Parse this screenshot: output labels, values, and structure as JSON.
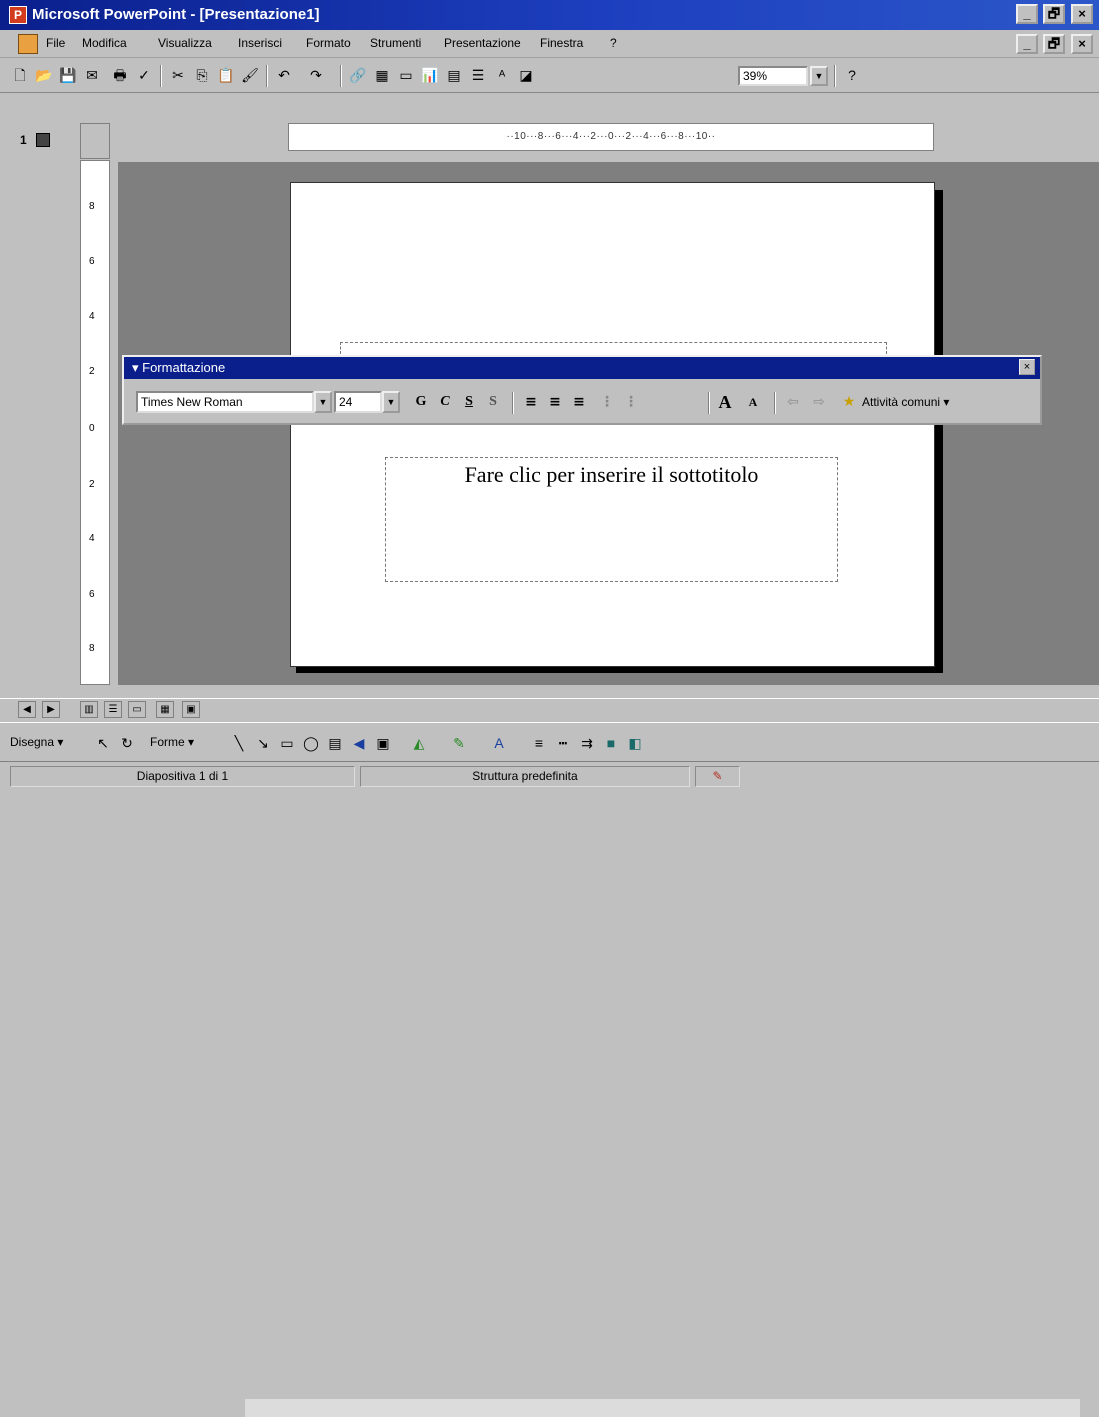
{
  "window": {
    "title": "Microsoft PowerPoint - [Presentazione1]",
    "minimize": "_",
    "restore": "🗗",
    "close": "×"
  },
  "menu": {
    "items": [
      "File",
      "Modifica",
      "Visualizza",
      "Inserisci",
      "Formato",
      "Strumenti",
      "Presentazione",
      "Finestra",
      "?"
    ]
  },
  "toolbar": {
    "zoom": "39%"
  },
  "slide_panel": {
    "number": "1"
  },
  "ruler": {
    "horizontal_ticks": "··10···8···6···4···2···0···2···4···6···8···10··",
    "vertical_ticks": [
      "8",
      "6",
      "4",
      "2",
      "0",
      "2",
      "4",
      "6",
      "8"
    ]
  },
  "slide": {
    "subtitle_placeholder": "Fare clic per inserire il sottotitolo"
  },
  "formatting_toolbar": {
    "title": "▾ Formattazione",
    "font": "Times New Roman",
    "size": "24",
    "bold": "G",
    "italic": "C",
    "underline": "S",
    "shadow": "S",
    "common_tasks": "Attività comuni ▾"
  },
  "draw_toolbar": {
    "draw_label": "Disegna ▾",
    "shapes_label": "Forme ▾"
  },
  "status": {
    "slide_count": "Diapositiva 1 di 1",
    "design": "Struttura predefinita"
  }
}
